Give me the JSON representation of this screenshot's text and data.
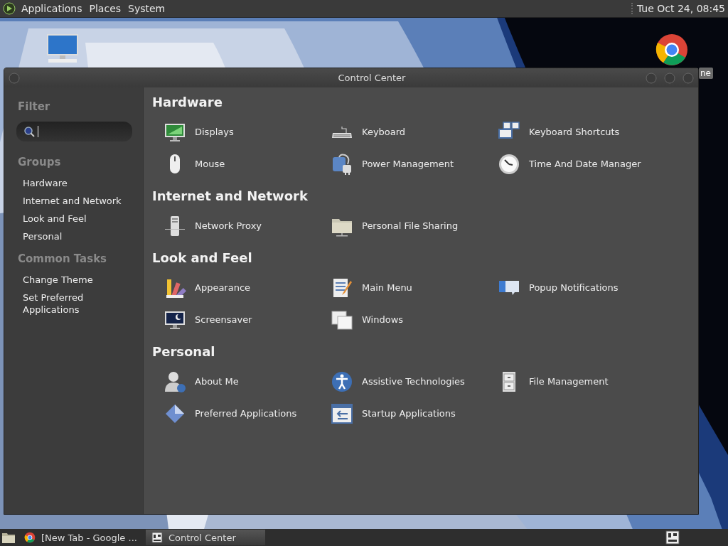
{
  "top_panel": {
    "menus": [
      "Applications",
      "Places",
      "System"
    ],
    "clock": "Tue Oct 24, 08:45"
  },
  "desktop": {
    "icons": [
      {
        "kind": "computer"
      },
      {
        "kind": "browser",
        "label": "ne"
      }
    ]
  },
  "window": {
    "title": "Control Center",
    "sidebar": {
      "filter_heading": "Filter",
      "search": {
        "kind": "empty"
      },
      "groups_heading": "Groups",
      "groups": [
        "Hardware",
        "Internet and Network",
        "Look and Feel",
        "Personal"
      ],
      "tasks_heading": "Common Tasks",
      "tasks": [
        "Change Theme",
        "Set Preferred Applications"
      ]
    },
    "sections": [
      {
        "title": "Hardware",
        "items": [
          {
            "label": "Displays",
            "kind": "display"
          },
          {
            "label": "Keyboard",
            "kind": "keyboard"
          },
          {
            "label": "Keyboard Shortcuts",
            "kind": "shortcuts"
          },
          {
            "label": "Mouse",
            "kind": "mouse"
          },
          {
            "label": "Power Management",
            "kind": "power"
          },
          {
            "label": "Time And Date Manager",
            "kind": "clock"
          }
        ]
      },
      {
        "title": "Internet and Network",
        "items": [
          {
            "label": "Network Proxy",
            "kind": "proxy"
          },
          {
            "label": "Personal File Sharing",
            "kind": "folder"
          }
        ]
      },
      {
        "title": "Look and Feel",
        "items": [
          {
            "label": "Appearance",
            "kind": "palette"
          },
          {
            "label": "Main Menu",
            "kind": "menu"
          },
          {
            "label": "Popup Notifications",
            "kind": "popup"
          },
          {
            "label": "Screensaver",
            "kind": "screensaver"
          },
          {
            "label": "Windows",
            "kind": "windows"
          }
        ]
      },
      {
        "title": "Personal",
        "items": [
          {
            "label": "About Me",
            "kind": "person"
          },
          {
            "label": "Assistive Technologies",
            "kind": "accessibility"
          },
          {
            "label": "File Management",
            "kind": "cabinet"
          },
          {
            "label": "Preferred Applications",
            "kind": "diamond"
          },
          {
            "label": "Startup Applications",
            "kind": "startup"
          }
        ]
      }
    ]
  },
  "taskbar": {
    "tasks": [
      {
        "label": "[New Tab - Google ...",
        "kind": "browser",
        "selected": false
      },
      {
        "label": "Control Center",
        "kind": "controlcenter",
        "selected": true
      }
    ]
  }
}
